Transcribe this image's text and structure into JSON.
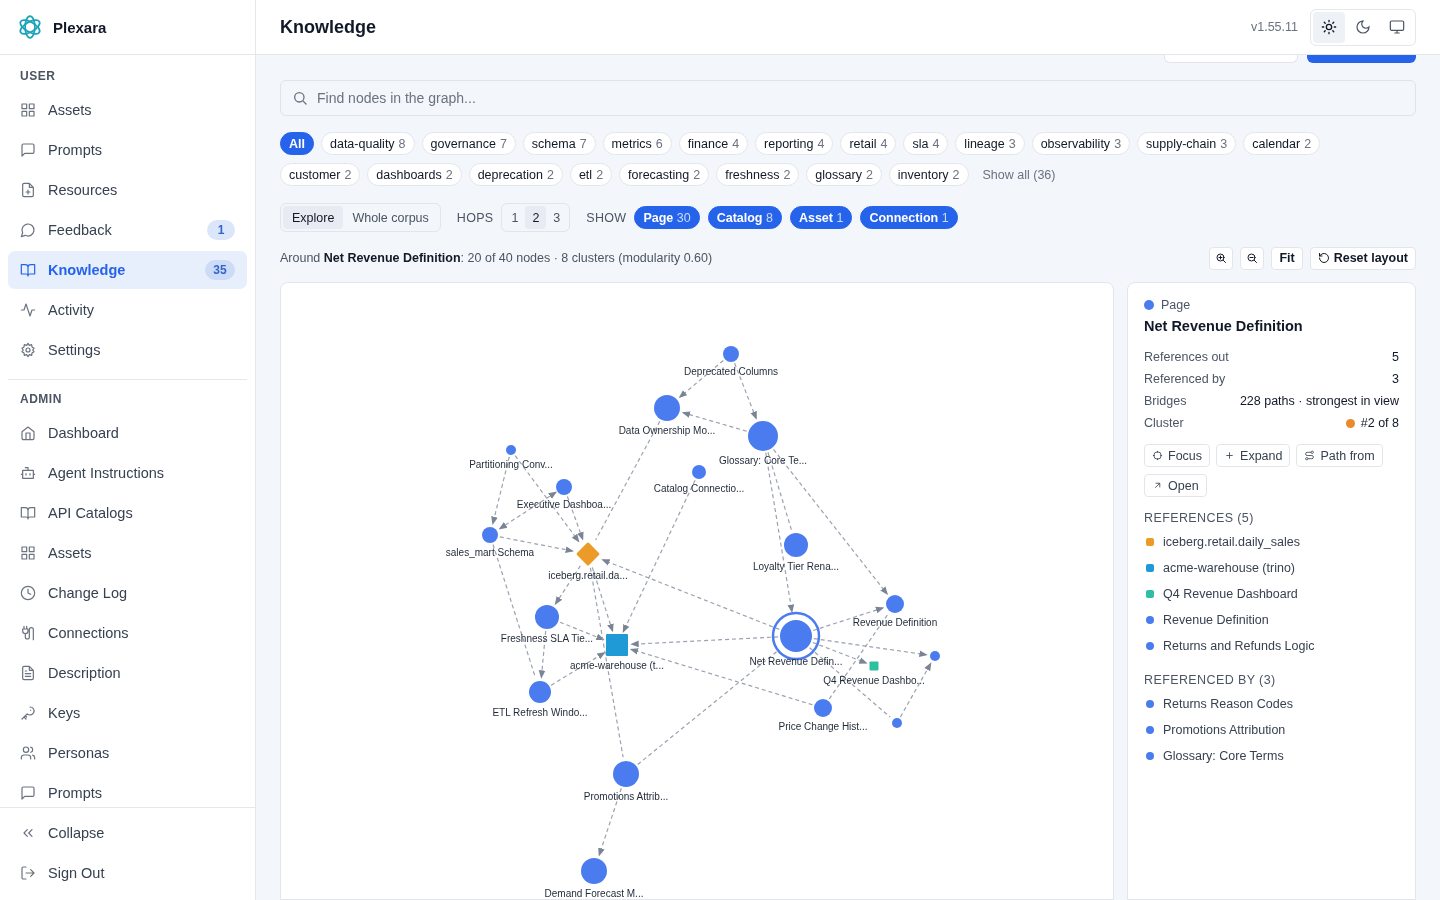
{
  "sidebar": {
    "brand": "Plexara",
    "sections": [
      {
        "title": "USER",
        "items": [
          {
            "label": "Assets",
            "selected": false
          },
          {
            "label": "Prompts",
            "selected": false
          },
          {
            "label": "Resources",
            "selected": false
          },
          {
            "label": "Feedback",
            "badge": "1",
            "selected": false
          },
          {
            "label": "Knowledge",
            "badge": "35",
            "selected": true
          },
          {
            "label": "Activity",
            "selected": false
          },
          {
            "label": "Settings",
            "selected": false
          }
        ]
      },
      {
        "title": "ADMIN",
        "items": [
          {
            "label": "Dashboard",
            "selected": false
          },
          {
            "label": "Agent Instructions",
            "selected": false
          },
          {
            "label": "API Catalogs",
            "selected": false
          },
          {
            "label": "Assets",
            "selected": false
          },
          {
            "label": "Change Log",
            "selected": false
          },
          {
            "label": "Connections",
            "selected": false
          },
          {
            "label": "Description",
            "selected": false
          },
          {
            "label": "Keys",
            "selected": false
          },
          {
            "label": "Personas",
            "selected": false
          },
          {
            "label": "Prompts",
            "selected": false
          }
        ]
      }
    ],
    "footer": [
      "Collapse",
      "Sign Out"
    ]
  },
  "header": {
    "title": "Knowledge",
    "version": "v1.55.11",
    "theme": [
      {
        "selected": true
      },
      {
        "selected": false
      },
      {
        "selected": false
      }
    ]
  },
  "search": {
    "placeholder": "Find nodes in the graph..."
  },
  "tags": {
    "items": [
      {
        "label": "All",
        "selected": true
      },
      {
        "label": "data-quality",
        "count": "8",
        "selected": false
      },
      {
        "label": "governance",
        "count": "7",
        "selected": false
      },
      {
        "label": "schema",
        "count": "7",
        "selected": false
      },
      {
        "label": "metrics",
        "count": "6",
        "selected": false
      },
      {
        "label": "finance",
        "count": "4",
        "selected": false
      },
      {
        "label": "reporting",
        "count": "4",
        "selected": false
      },
      {
        "label": "retail",
        "count": "4",
        "selected": false
      },
      {
        "label": "sla",
        "count": "4",
        "selected": false
      },
      {
        "label": "lineage",
        "count": "3",
        "selected": false
      },
      {
        "label": "observability",
        "count": "3",
        "selected": false
      },
      {
        "label": "supply-chain",
        "count": "3",
        "selected": false
      },
      {
        "label": "calendar",
        "count": "2",
        "selected": false
      },
      {
        "label": "customer",
        "count": "2",
        "selected": false
      },
      {
        "label": "dashboards",
        "count": "2",
        "selected": false
      },
      {
        "label": "deprecation",
        "count": "2",
        "selected": false
      },
      {
        "label": "etl",
        "count": "2",
        "selected": false
      },
      {
        "label": "forecasting",
        "count": "2",
        "selected": false
      },
      {
        "label": "freshness",
        "count": "2",
        "selected": false
      },
      {
        "label": "glossary",
        "count": "2",
        "selected": false
      },
      {
        "label": "inventory",
        "count": "2",
        "selected": false
      }
    ],
    "show_all": "Show all (36)"
  },
  "modes": [
    {
      "label": "Explore",
      "selected": true
    },
    {
      "label": "Whole corpus",
      "selected": false
    }
  ],
  "hops": {
    "label": "HOPS",
    "options": [
      {
        "label": "1",
        "selected": false
      },
      {
        "label": "2",
        "selected": true
      },
      {
        "label": "3",
        "selected": false
      }
    ]
  },
  "show": {
    "label": "SHOW",
    "filters": [
      {
        "label": "Page",
        "count": "30",
        "on": true
      },
      {
        "label": "Catalog",
        "count": "8",
        "on": true
      },
      {
        "label": "Asset",
        "count": "1",
        "on": true
      },
      {
        "label": "Connection",
        "count": "1",
        "on": true
      }
    ]
  },
  "summary": "Around **Net Revenue Definition**: 20 of 40 nodes · 8 clusters (modularity 0.60)",
  "graph_tools": {
    "fit": "Fit",
    "reset": "Reset layout"
  },
  "graph": {
    "nodes": [
      {
        "label": "Deprecated Columns",
        "kind": "page",
        "selected": false
      },
      {
        "label": "Data Ownership Mo...",
        "kind": "page",
        "selected": false
      },
      {
        "label": "Glossary: Core Te...",
        "kind": "page",
        "selected": false
      },
      {
        "label": "Partitioning Conv...",
        "kind": "page",
        "selected": false
      },
      {
        "label": "Catalog Connectio...",
        "kind": "page",
        "selected": false
      },
      {
        "label": "Executive Dashboa...",
        "kind": "page",
        "selected": false
      },
      {
        "label": "sales_mart Schema",
        "kind": "page",
        "selected": false
      },
      {
        "label": "iceberg.retail.da...",
        "kind": "catalog",
        "selected": false
      },
      {
        "label": "Loyalty Tier Rena...",
        "kind": "page",
        "selected": false
      },
      {
        "label": "Revenue Definition",
        "kind": "page",
        "selected": false
      },
      {
        "label": "Freshness SLA Tie...",
        "kind": "page",
        "selected": false
      },
      {
        "label": "acme-warehouse (t...",
        "kind": "connection",
        "selected": false
      },
      {
        "label": "Net Revenue Defin...",
        "kind": "page",
        "selected": true
      },
      {
        "kind": "page",
        "selected": false
      },
      {
        "label": "Q4 Revenue Dashbo...",
        "kind": "asset",
        "selected": false
      },
      {
        "label": "ETL Refresh Windo...",
        "kind": "page",
        "selected": false
      },
      {
        "label": "Price Change Hist...",
        "kind": "page",
        "selected": false
      },
      {
        "kind": "page",
        "selected": false
      },
      {
        "label": "Promotions Attrib...",
        "kind": "page",
        "selected": false
      },
      {
        "label": "Demand Forecast M...",
        "kind": "page",
        "selected": false
      }
    ]
  },
  "details": {
    "kind": "page",
    "type": "Page",
    "title": "Net Revenue Definition",
    "stats": [
      {
        "label": "References out",
        "value": "5"
      },
      {
        "label": "Referenced by",
        "value": "3"
      },
      {
        "label": "Bridges",
        "value": "228 paths · strongest in view"
      },
      {
        "label": "Cluster",
        "value": "#2 of 8",
        "color": "#ea8a2a"
      }
    ],
    "actions": [
      "Focus",
      "Expand",
      "Path from",
      "Open"
    ],
    "groups": [
      {
        "title": "REFERENCES (5)",
        "items": [
          {
            "label": "iceberg.retail.daily_sales",
            "kind": "catalog"
          },
          {
            "label": "acme-warehouse (trino)",
            "kind": "connection"
          },
          {
            "label": "Q4 Revenue Dashboard",
            "kind": "asset"
          },
          {
            "label": "Revenue Definition",
            "kind": "page"
          },
          {
            "label": "Returns and Refunds Logic",
            "kind": "page"
          }
        ]
      },
      {
        "title": "REFERENCED BY (3)",
        "items": [
          {
            "label": "Returns Reason Codes",
            "kind": "page"
          },
          {
            "label": "Promotions Attribution",
            "kind": "page"
          },
          {
            "label": "Glossary: Core Terms",
            "kind": "page"
          }
        ]
      }
    ]
  }
}
